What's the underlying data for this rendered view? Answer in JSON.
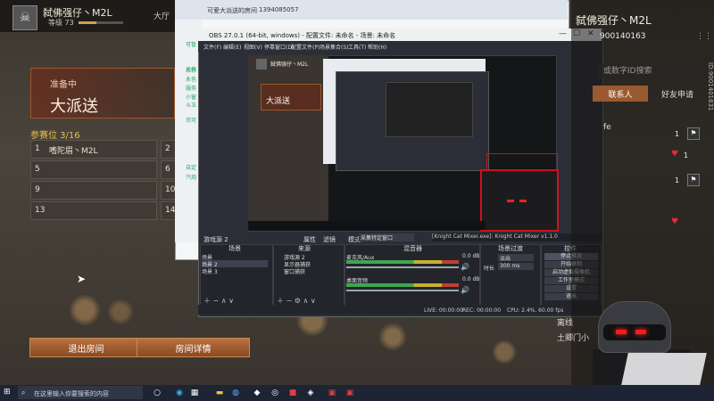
{
  "game": {
    "player_name": "弑佛强仔丶M2L",
    "level_label": "等级 73",
    "lobby_tab": "大厅",
    "room_status": "准备中",
    "room_mode": "大派送",
    "slots_title": "参赛位 3/16",
    "slots_left": [
      {
        "num": "1",
        "name": "嗜陀眉丶M2L"
      },
      {
        "num": "5",
        "name": ""
      },
      {
        "num": "9",
        "name": ""
      },
      {
        "num": "13",
        "name": ""
      }
    ],
    "slots_right": [
      {
        "num": "2",
        "name": ""
      },
      {
        "num": "6",
        "name": ""
      },
      {
        "num": "10",
        "name": ""
      },
      {
        "num": "14",
        "name": ""
      }
    ],
    "exit_button": "退出房间",
    "details_button": "房间详情"
  },
  "browser": {
    "tab_title": "可爱大派送的房间",
    "tab_id": "1394085057",
    "chat_lines": [
      "可暂",
      "名称",
      "光作",
      "永色",
      "服务",
      "小窗",
      "斗玉",
      "司可",
      "自定",
      "汽炮"
    ]
  },
  "obs": {
    "title": "OBS 27.0.1 (64-bit, windows) - 配置文件: 未命名 - 场景: 未命名",
    "controls": {
      "minimize": "—",
      "maximize": "☐",
      "close": "✕"
    },
    "menu": [
      "文件(F)",
      "编辑(E)",
      "视图(V)",
      "停靠窗口(D)",
      "配置文件(P)",
      "场景集合(S)",
      "工具(T)",
      "帮助(H)"
    ],
    "preview": {
      "player_name": "弑佛强仔丶M2L",
      "room_mode": "大派送"
    },
    "scene_label": "游戏源 2",
    "properties": "属性",
    "filters": "滤镜",
    "mode_label": "模式",
    "mode_value": "采集特定窗口",
    "mixer_bar": "[Knight Cat Mixer.exe]: Knight Cat Mixer v1.1.0",
    "docks": {
      "scenes": {
        "title": "场景",
        "items": [
          "场景",
          "场景 2",
          "场景 3"
        ]
      },
      "sources": {
        "title": "来源",
        "items": [
          "游戏源 2",
          "显示器捕获",
          "窗口捕获"
        ]
      },
      "mixer": {
        "title": "混音器",
        "channels": [
          {
            "name": "麦克风/Aux",
            "level": "0.0 dB"
          },
          {
            "name": "桌面音频",
            "level": "0.0 dB"
          }
        ]
      },
      "transitions": {
        "title": "场景过渡",
        "type": "淡出",
        "duration_label": "时长",
        "duration": "300 ms"
      },
      "controls": {
        "title": "控件",
        "buttons": [
          "停止推流",
          "开始录制",
          "启动虚拟摄像机",
          "工作室模式",
          "设置",
          "退出"
        ]
      }
    },
    "status": {
      "live": "LIVE: 00:00:00",
      "rec": "REC: 00:00:00",
      "cpu": "CPU: 2.4%, 60.00 fps"
    }
  },
  "friends": {
    "name": "弑佛强仔丶M2L",
    "id": "900140163",
    "search_placeholder": "或数字ID搜索",
    "tab_contacts": "联系人",
    "tab_requests": "好友申请",
    "fe_label": "fe",
    "counts": [
      "1",
      "1",
      "1",
      "1"
    ],
    "friend1": "离线",
    "friend2": "土卿门小",
    "side_id": "ID:9001401631"
  },
  "taskbar": {
    "search_placeholder": "在这里输入你要搜索的内容",
    "icons": [
      "start-icon",
      "task-view-icon",
      "edge-icon",
      "store-icon",
      "file-explorer-icon",
      "steam-icon",
      "game-icon",
      "obs-icon"
    ]
  },
  "colors": {
    "accent": "#9a5a30",
    "obs_bg": "#2b2e36",
    "highlight_red": "#d01020"
  }
}
